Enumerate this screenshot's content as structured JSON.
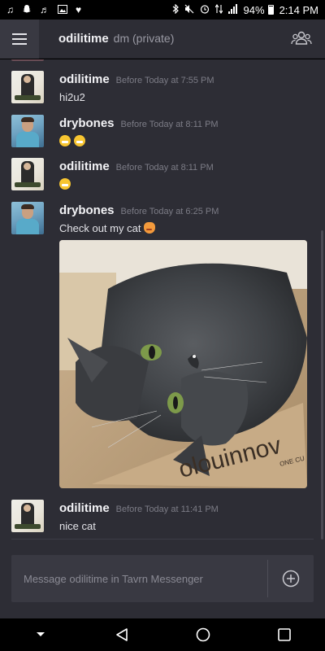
{
  "status_bar": {
    "time": "2:14 PM",
    "battery_percent": "94%",
    "battery_level": 0.94,
    "left_icons": [
      "music-note-icon",
      "snapchat-icon",
      "music-note-2-icon",
      "image-icon",
      "heart-icon"
    ],
    "right_icons": [
      "bluetooth-icon",
      "mute-icon",
      "alarm-icon",
      "data-icon",
      "signal-icon",
      "battery-icon"
    ]
  },
  "header": {
    "title": "odilitime",
    "subtitle": "dm (private)",
    "menu_icon": "hamburger-icon",
    "users_icon": "users-icon"
  },
  "messages": [
    {
      "author": "odilitime",
      "timestamp": "Before Today at 7:55 PM",
      "text": "hi2u2"
    },
    {
      "author": "drybones",
      "timestamp": "Before Today at 8:11 PM",
      "emojis": [
        "grinning-emoji",
        "grinning-emoji"
      ]
    },
    {
      "author": "odilitime",
      "timestamp": "Before Today at 8:11 PM",
      "emojis": [
        "grinning-emoji"
      ]
    },
    {
      "author": "drybones",
      "timestamp": "Before Today at 6:25 PM",
      "text": "Check out my cat",
      "emojis": [
        "cat-face-emoji"
      ],
      "has_image": true,
      "image_caption_text": "olouinnov",
      "image_caption_sub": "ONE CU"
    },
    {
      "author": "odilitime",
      "timestamp": "Before Today at 11:41 PM",
      "text": "nice cat"
    }
  ],
  "composer": {
    "placeholder": "Message odilitime in Tavrn Messenger",
    "add_icon": "plus-circle-icon"
  },
  "nav_bar": {
    "items": [
      "chevron-down-icon",
      "back-triangle-icon",
      "home-circle-icon",
      "recents-square-icon"
    ]
  },
  "colors": {
    "background": "#2d2d35",
    "input_background": "#393942",
    "text_primary": "#f3f3f6",
    "text_muted": "#7c7c86"
  }
}
